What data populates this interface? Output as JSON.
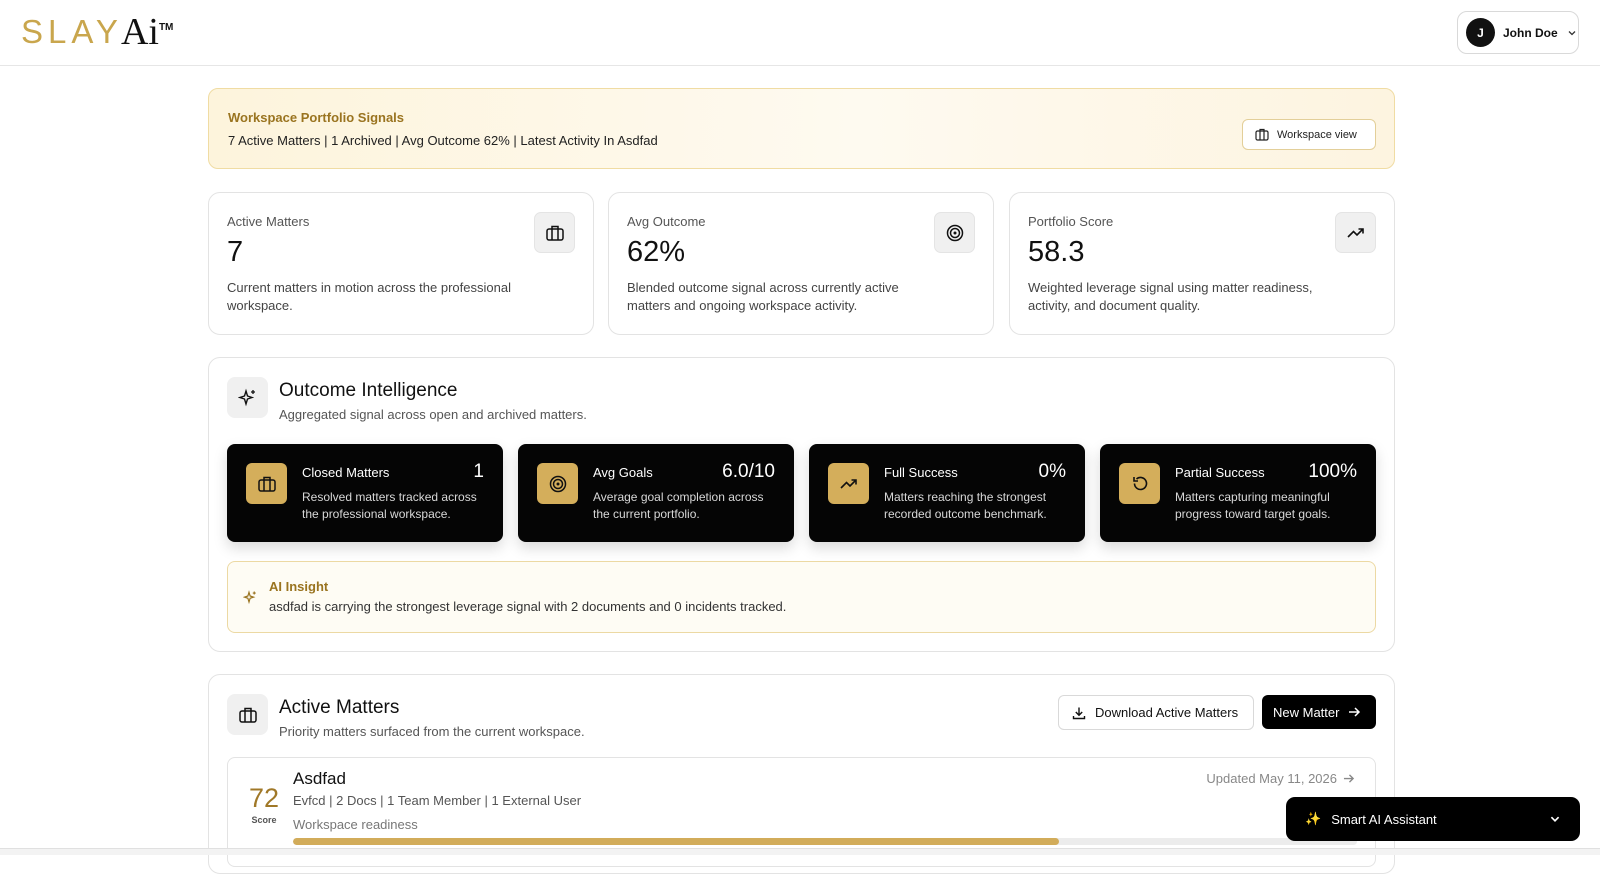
{
  "brand": {
    "name": "SLAY",
    "suffix": "Ai",
    "tm": "TM"
  },
  "user": {
    "initial": "J",
    "name": "John Doe"
  },
  "banner": {
    "title": "Workspace Portfolio Signals",
    "summary": "7 Active Matters | 1 Archived | Avg Outcome 62% | Latest Activity In Asdfad",
    "button_label": "Workspace view"
  },
  "stats": [
    {
      "label": "Active Matters",
      "value": "7",
      "description": "Current matters in motion across the professional workspace.",
      "icon": "briefcase-icon"
    },
    {
      "label": "Avg Outcome",
      "value": "62%",
      "description": "Blended outcome signal across currently active matters and ongoing workspace activity.",
      "icon": "target-icon"
    },
    {
      "label": "Portfolio Score",
      "value": "58.3",
      "description": "Weighted leverage signal using matter readiness, activity, and document quality.",
      "icon": "trending-up-icon"
    }
  ],
  "outcome_intelligence": {
    "title": "Outcome Intelligence",
    "subtitle": "Aggregated signal across open and archived matters.",
    "cards": [
      {
        "title": "Closed Matters",
        "value": "1",
        "description": "Resolved matters tracked across the professional workspace.",
        "icon": "briefcase-icon"
      },
      {
        "title": "Avg Goals",
        "value": "6.0/10",
        "description": "Average goal completion across the current portfolio.",
        "icon": "target-icon"
      },
      {
        "title": "Full Success",
        "value": "0%",
        "description": "Matters reaching the strongest recorded outcome benchmark.",
        "icon": "trending-up-icon"
      },
      {
        "title": "Partial Success",
        "value": "100%",
        "description": "Matters capturing meaningful progress toward target goals.",
        "icon": "rotate-icon"
      }
    ],
    "insight": {
      "title": "AI Insight",
      "text": "asdfad is carrying the strongest leverage signal with 2 documents and 0 incidents tracked."
    }
  },
  "active_matters": {
    "title": "Active Matters",
    "subtitle": "Priority matters surfaced from the current workspace.",
    "download_label": "Download Active Matters",
    "new_label": "New Matter",
    "items": [
      {
        "score": "72",
        "score_label": "Score",
        "title": "Asdfad",
        "meta": "Evfcd | 2 Docs | 1 Team Member | 1 External User",
        "readiness_label": "Workspace readiness",
        "updated": "Updated May 11, 2026",
        "readiness": 0.72
      }
    ]
  },
  "assistant": {
    "label": "Smart AI Assistant",
    "spark": "✨"
  },
  "colors": {
    "gold": "#c9a64d",
    "gold_dark": "#9a7420",
    "dark_card": "#050505"
  }
}
